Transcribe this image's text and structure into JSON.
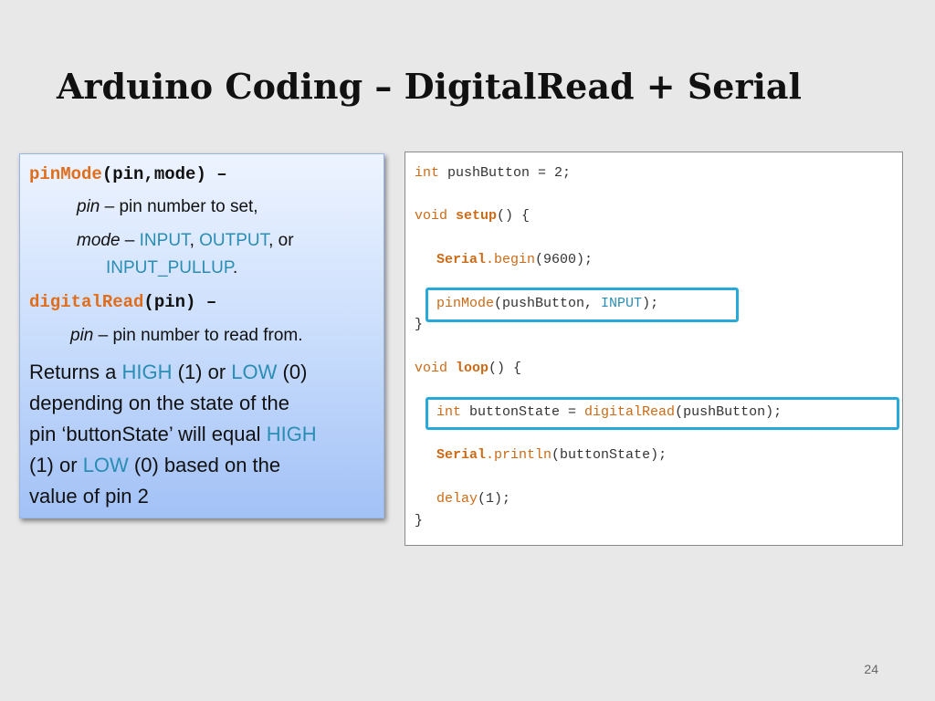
{
  "slide": {
    "title": "Arduino Coding – DigitalRead + Serial",
    "page_number": "24"
  },
  "left_panel": {
    "pinmode_fn": "pinMode",
    "pinmode_args": "(pin,mode)",
    "dash": " –",
    "pin_label": "pin",
    "pin_desc": " – pin number to set,",
    "mode_label": "mode",
    "mode_sep": " – ",
    "mode_input": "INPUT",
    "comma": ",",
    "mode_output": "OUTPUT",
    "mode_or": ", or",
    "mode_input_pullup": "INPUT_PULLUP",
    "period": ".",
    "digitalread_fn": "digitalRead",
    "digitalread_args": "(pin)",
    "read_pin_label": "pin",
    "read_pin_desc": " – pin number to read from.",
    "returns_1": "Returns a ",
    "high": "HIGH",
    "one_or": " (1) or  ",
    "low": "LOW",
    "zero": " (0)",
    "line_2": "depending on the state of the",
    "line_3_a": "pin ‘buttonState’ will equal ",
    "line_4_a": "(1) or  ",
    "line_4_b": " (0) based on the",
    "line_5": "value of pin 2"
  },
  "code": {
    "l1_kw": "int",
    "l1_rest": " pushButton = 2;",
    "l2_kw": "void",
    "l2_fn": "setup",
    "l2_rest": "() {",
    "l3_cls": "Serial",
    "l3_dot": ".",
    "l3_meth": "begin",
    "l3_rest": "(9600);",
    "l4_fn": "pinMode",
    "l4_mid": "(pushButton, ",
    "l4_const": "INPUT",
    "l4_end": ");",
    "l5": "}",
    "l6_kw": "void",
    "l6_fn": "loop",
    "l6_rest": "() {",
    "l7_kw": "int",
    "l7_mid": " buttonState = ",
    "l7_fn": "digitalRead",
    "l7_end": "(pushButton);",
    "l8_cls": "Serial",
    "l8_dot": ".",
    "l8_meth": "println",
    "l8_rest": "(buttonState);",
    "l9_fn": "delay",
    "l9_rest": "(1);",
    "l10": "}"
  },
  "colors": {
    "keyword": "#cc6a16",
    "constant": "#2a8db3",
    "highlight": "#27a9d9"
  }
}
